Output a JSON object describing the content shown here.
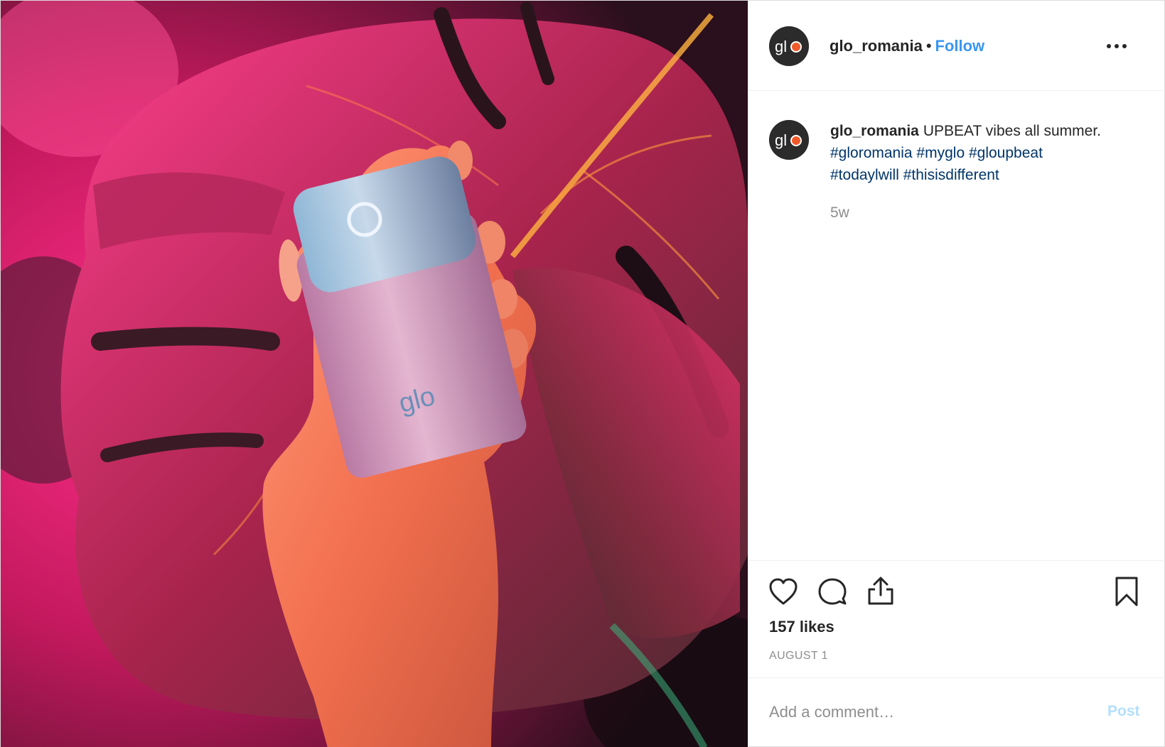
{
  "post": {
    "account": {
      "username": "glo_romania",
      "separator": "•",
      "follow_label": "Follow",
      "avatar_logo_icon": "glo-logo-icon"
    },
    "more_icon": "ellipsis-icon",
    "caption": {
      "username": "glo_romania",
      "text": "UPBEAT vibes all summer.",
      "hashtags": [
        "#gloromania",
        "#myglo",
        "#gloupbeat",
        "#todaylwill",
        "#thisisdifferent"
      ],
      "time_ago": "5w"
    },
    "actions": {
      "like_icon": "heart-icon",
      "comment_icon": "comment-bubble-icon",
      "share_icon": "share-upload-icon",
      "save_icon": "bookmark-icon"
    },
    "likes": "157 likes",
    "date": "AUGUST 1",
    "comment": {
      "placeholder": "Add a comment…",
      "post_label": "Post"
    },
    "photo": {
      "device_logo": "glo"
    },
    "colors": {
      "link_blue": "#3897f0",
      "hashtag_blue": "#003569",
      "muted_gray": "#8e8e8e",
      "post_disabled": "#b2dffc"
    }
  }
}
